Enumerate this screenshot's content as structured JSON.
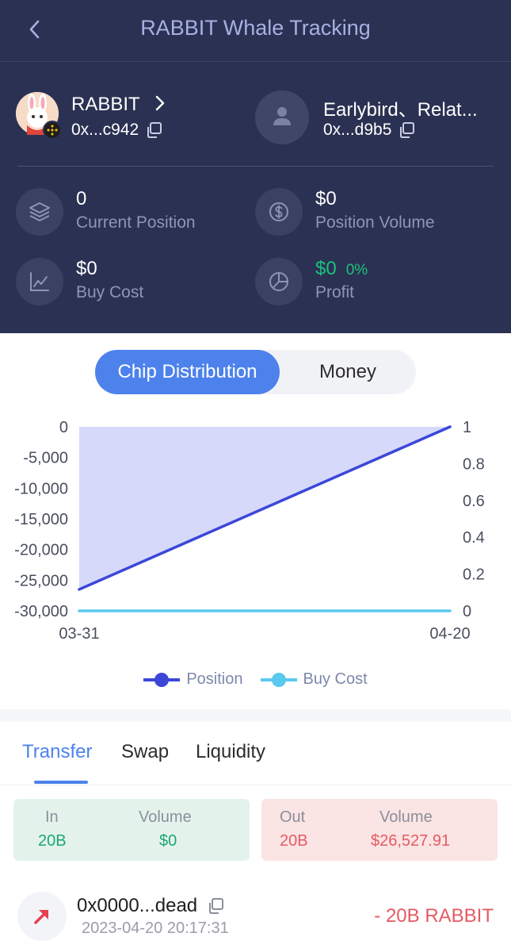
{
  "header": {
    "title": "RABBIT Whale Tracking",
    "token": {
      "name": "RABBIT",
      "address": "0x...c942",
      "avatar_icon": "rabbit-avatar",
      "chain_icon": "bnb-chain-badge"
    },
    "wallet": {
      "name": "Earlybird、Relat...",
      "address": "0x...d9b5",
      "avatar_icon": "user-icon"
    }
  },
  "stats": {
    "current_position": {
      "value": "0",
      "label": "Current Position",
      "icon": "layers-icon"
    },
    "position_volume": {
      "value": "$0",
      "label": "Position Volume",
      "icon": "dollar-circle-icon"
    },
    "buy_cost": {
      "value": "$0",
      "label": "Buy Cost",
      "icon": "trend-chart-icon"
    },
    "profit": {
      "value": "$0",
      "percent": "0%",
      "label": "Profit",
      "icon": "pie-chart-icon"
    }
  },
  "segment": {
    "active": "Chip Distribution",
    "other": "Money"
  },
  "chart_data": {
    "type": "line",
    "x": [
      "03-31",
      "04-20"
    ],
    "series": [
      {
        "name": "Position",
        "values": [
          -26500,
          0
        ],
        "axis": "left",
        "color": "#3b47d8",
        "area_fill": "#d6d9fa"
      },
      {
        "name": "Buy Cost",
        "values": [
          0,
          0
        ],
        "axis": "right",
        "color": "#5bc8ee"
      }
    ],
    "y_left": {
      "ticks": [
        "0",
        "-5,000",
        "-10,000",
        "-15,000",
        "-20,000",
        "-25,000",
        "-30,000"
      ],
      "range": [
        -30000,
        0
      ]
    },
    "y_right": {
      "ticks": [
        "1",
        "0.8",
        "0.6",
        "0.4",
        "0.2",
        "0"
      ],
      "range": [
        0,
        1
      ]
    },
    "x_ticks": [
      "03-31",
      "04-20"
    ],
    "legend": "bottom-center",
    "grid": false
  },
  "tabs": [
    "Transfer",
    "Swap",
    "Liquidity"
  ],
  "summary": {
    "in": {
      "label": "In",
      "volume_label": "Volume",
      "count": "20B",
      "volume": "$0"
    },
    "out": {
      "label": "Out",
      "volume_label": "Volume",
      "count": "20B",
      "volume": "$26,527.91"
    }
  },
  "transactions": [
    {
      "address": "0x0000...dead",
      "time": "2023-04-20 20:17:31",
      "amount": "- 20B RABBIT",
      "direction_icon": "arrow-up-right-icon"
    }
  ]
}
